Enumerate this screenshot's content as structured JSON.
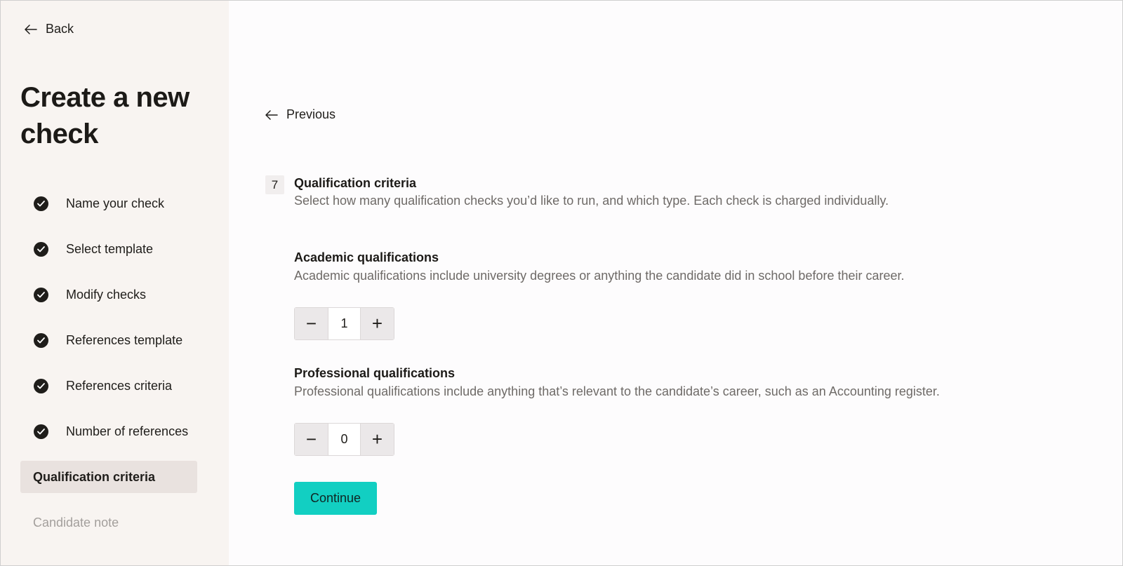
{
  "sidebar": {
    "back_label": "Back",
    "title": "Create a new check",
    "steps": [
      {
        "label": "Name your check",
        "status": "complete"
      },
      {
        "label": "Select template",
        "status": "complete"
      },
      {
        "label": "Modify checks",
        "status": "complete"
      },
      {
        "label": "References template",
        "status": "complete"
      },
      {
        "label": "References criteria",
        "status": "complete"
      },
      {
        "label": "Number of references",
        "status": "complete"
      },
      {
        "label": "Qualification criteria",
        "status": "active"
      },
      {
        "label": "Candidate note",
        "status": "pending"
      }
    ]
  },
  "main": {
    "previous_label": "Previous",
    "step_number": "7",
    "title": "Qualification criteria",
    "description": "Select how many qualification checks you’d like to run, and which type. Each check is charged individually.",
    "academic": {
      "title": "Academic qualifications",
      "description": "Academic qualifications include university degrees or anything the candidate did in school before their career.",
      "value": "1",
      "minus": "−",
      "plus": "+"
    },
    "professional": {
      "title": "Professional qualifications",
      "description": "Professional qualifications include anything that’s relevant to the candidate’s career, such as an Accounting register.",
      "value": "0",
      "minus": "−",
      "plus": "+"
    },
    "continue_label": "Continue"
  },
  "colors": {
    "sidebar_bg": "#f8f4f1",
    "active_step_bg": "#e9e2df",
    "accent": "#12cfc2",
    "text": "#1f1d1a",
    "muted": "#6e6a67"
  }
}
